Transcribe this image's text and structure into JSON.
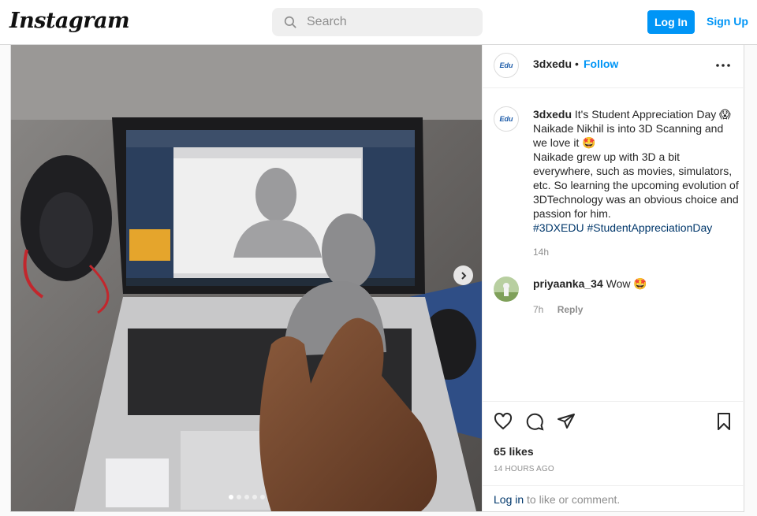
{
  "brand": {
    "logo_text": "Instagram"
  },
  "search": {
    "placeholder": "Search"
  },
  "auth": {
    "login_label": "Log In",
    "signup_label": "Sign Up"
  },
  "post": {
    "username": "3dxedu",
    "separator": "•",
    "follow_label": "Follow",
    "avatar_text": "Edu",
    "caption_lines": [
      "It's Student Appreciation Day 😱",
      "Naikade Nikhil is into 3D Scanning and we love it 🤩",
      "Naikade grew up with 3D a bit everywhere, such as movies, simulators, etc. So learning the upcoming evolution of 3DTechnology was an obvious choice and passion for him."
    ],
    "hashtags": [
      "#3DXEDU",
      "#StudentAppreciationDay"
    ],
    "caption_time": "14h",
    "comment": {
      "username": "priyaanka_34",
      "text": "Wow 🤩",
      "time": "7h",
      "reply_label": "Reply"
    },
    "likes": "65 likes",
    "posted_ago": "14 HOURS AGO",
    "login_prompt": {
      "link": "Log in",
      "rest": " to like or comment."
    },
    "carousel": {
      "total": 5,
      "active": 1
    }
  },
  "icons": [
    "search-icon",
    "more-icon",
    "heart-icon",
    "comment-icon",
    "share-icon",
    "bookmark-icon",
    "chevron-right-icon"
  ]
}
